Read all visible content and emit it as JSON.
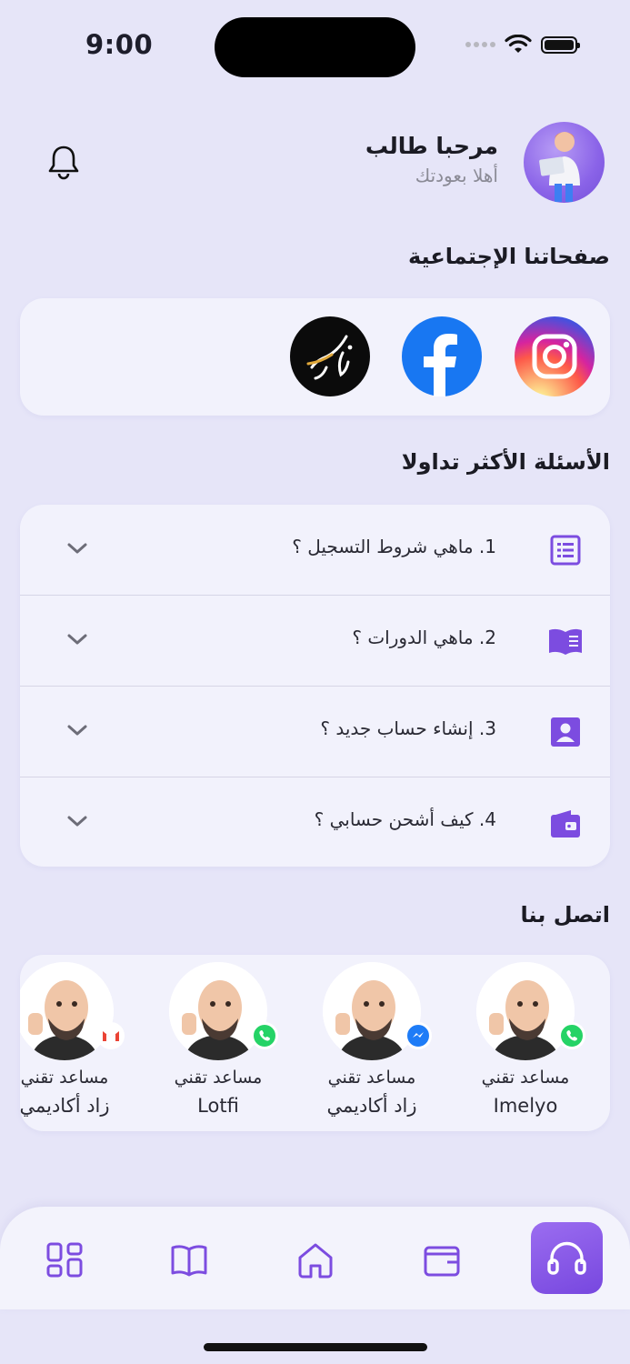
{
  "status_bar": {
    "time": "9:00"
  },
  "header": {
    "greeting": "مرحبا طالب",
    "subtitle": "أهلا بعودتك"
  },
  "social": {
    "title": "صفحاتنا الإجتماعية",
    "items": [
      {
        "name": "instagram",
        "icon": "instagram-icon"
      },
      {
        "name": "facebook",
        "icon": "facebook-icon"
      },
      {
        "name": "brand",
        "icon": "brand-logo"
      }
    ]
  },
  "faq": {
    "title": "الأسئلة الأكثر تداولا",
    "items": [
      {
        "label": "1. ماهي شروط التسجيل ؟",
        "icon": "list-icon"
      },
      {
        "label": "2. ماهي الدورات ؟",
        "icon": "book-icon"
      },
      {
        "label": "3. إنشاء حساب جديد ؟",
        "icon": "account-icon"
      },
      {
        "label": "4. كيف أشحن حسابي ؟",
        "icon": "wallet-icon"
      }
    ]
  },
  "contact": {
    "title": "اتصل بنا",
    "items": [
      {
        "role": "مساعد تقني",
        "name": "Imelyo",
        "channel": "whatsapp"
      },
      {
        "role": "مساعد تقني",
        "name": "زاد أكاديمي",
        "channel": "messenger"
      },
      {
        "role": "مساعد تقني",
        "name": "Lotfi",
        "channel": "whatsapp"
      },
      {
        "role": "مساعد تقني",
        "name": "زاد أكاديمي",
        "channel": "gmail"
      }
    ]
  },
  "nav": {
    "items": [
      "support",
      "wallet",
      "home",
      "courses",
      "dashboard"
    ],
    "active": "support"
  },
  "colors": {
    "accent": "#7c4ce0",
    "background": "#e6e5f8",
    "card": "#f2f2fc"
  }
}
